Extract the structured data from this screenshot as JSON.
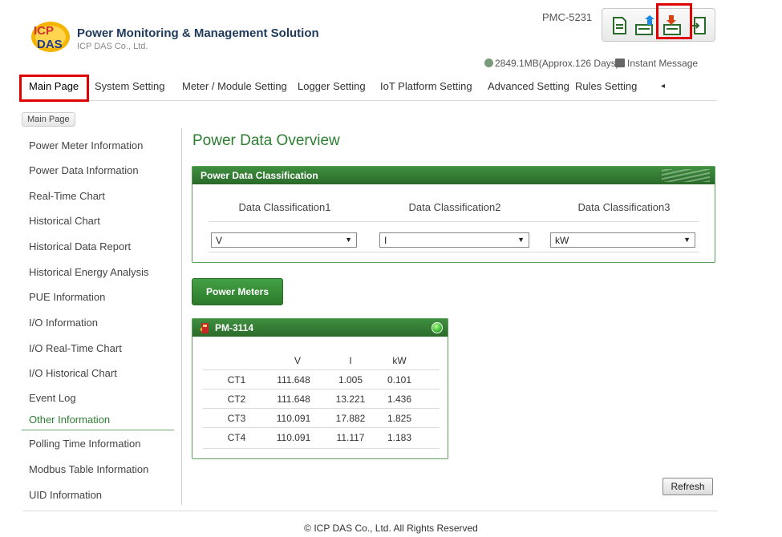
{
  "header": {
    "app_title": "Power Monitoring & Management Solution",
    "company": "ICP DAS Co., Ltd.",
    "model": "PMC-5231",
    "storage": "2849.1MB(Approx.126 Days)",
    "instant_message": "Instant Message",
    "toolbar_icons": [
      "document-icon",
      "upload-icon",
      "download-icon",
      "logout-icon"
    ]
  },
  "nav": {
    "items": [
      "Main Page",
      "System Setting",
      "Meter / Module Setting",
      "Logger Setting",
      "IoT Platform Setting",
      "Advanced Setting",
      "Rules Setting",
      "◂"
    ]
  },
  "breadcrumb": "Main Page",
  "sidebar": {
    "items": [
      "Power Meter Information",
      "Power Data Information",
      "Real-Time Chart",
      "Historical Chart",
      "Historical Data Report",
      "Historical Energy Analysis",
      "PUE Information",
      "I/O Information",
      "I/O Real-Time Chart",
      "I/O Historical Chart",
      "Event Log",
      "Other Information",
      "Polling Time Information",
      "Modbus Table Information",
      "UID Information"
    ],
    "active_index": 11
  },
  "main": {
    "title": "Power Data Overview",
    "classification": {
      "header": "Power Data Classification",
      "labels": [
        "Data Classification1",
        "Data Classification2",
        "Data Classification3"
      ],
      "values": [
        "V",
        "I",
        "kW"
      ]
    },
    "power_meters_button": "Power Meters",
    "meter": {
      "name": "PM-3114",
      "columns": [
        "V",
        "I",
        "kW"
      ],
      "rows": [
        {
          "ct": "CT1",
          "v": "111.648",
          "i": "1.005",
          "kw": "0.101"
        },
        {
          "ct": "CT2",
          "v": "111.648",
          "i": "13.221",
          "kw": "1.436"
        },
        {
          "ct": "CT3",
          "v": "110.091",
          "i": "17.882",
          "kw": "1.825"
        },
        {
          "ct": "CT4",
          "v": "110.091",
          "i": "11.117",
          "kw": "1.183"
        }
      ]
    },
    "refresh_label": "Refresh"
  },
  "footer": "© ICP DAS Co., Ltd. All Rights Reserved",
  "colors": {
    "accent_green": "#2e7d32",
    "highlight_red": "#e00000"
  }
}
